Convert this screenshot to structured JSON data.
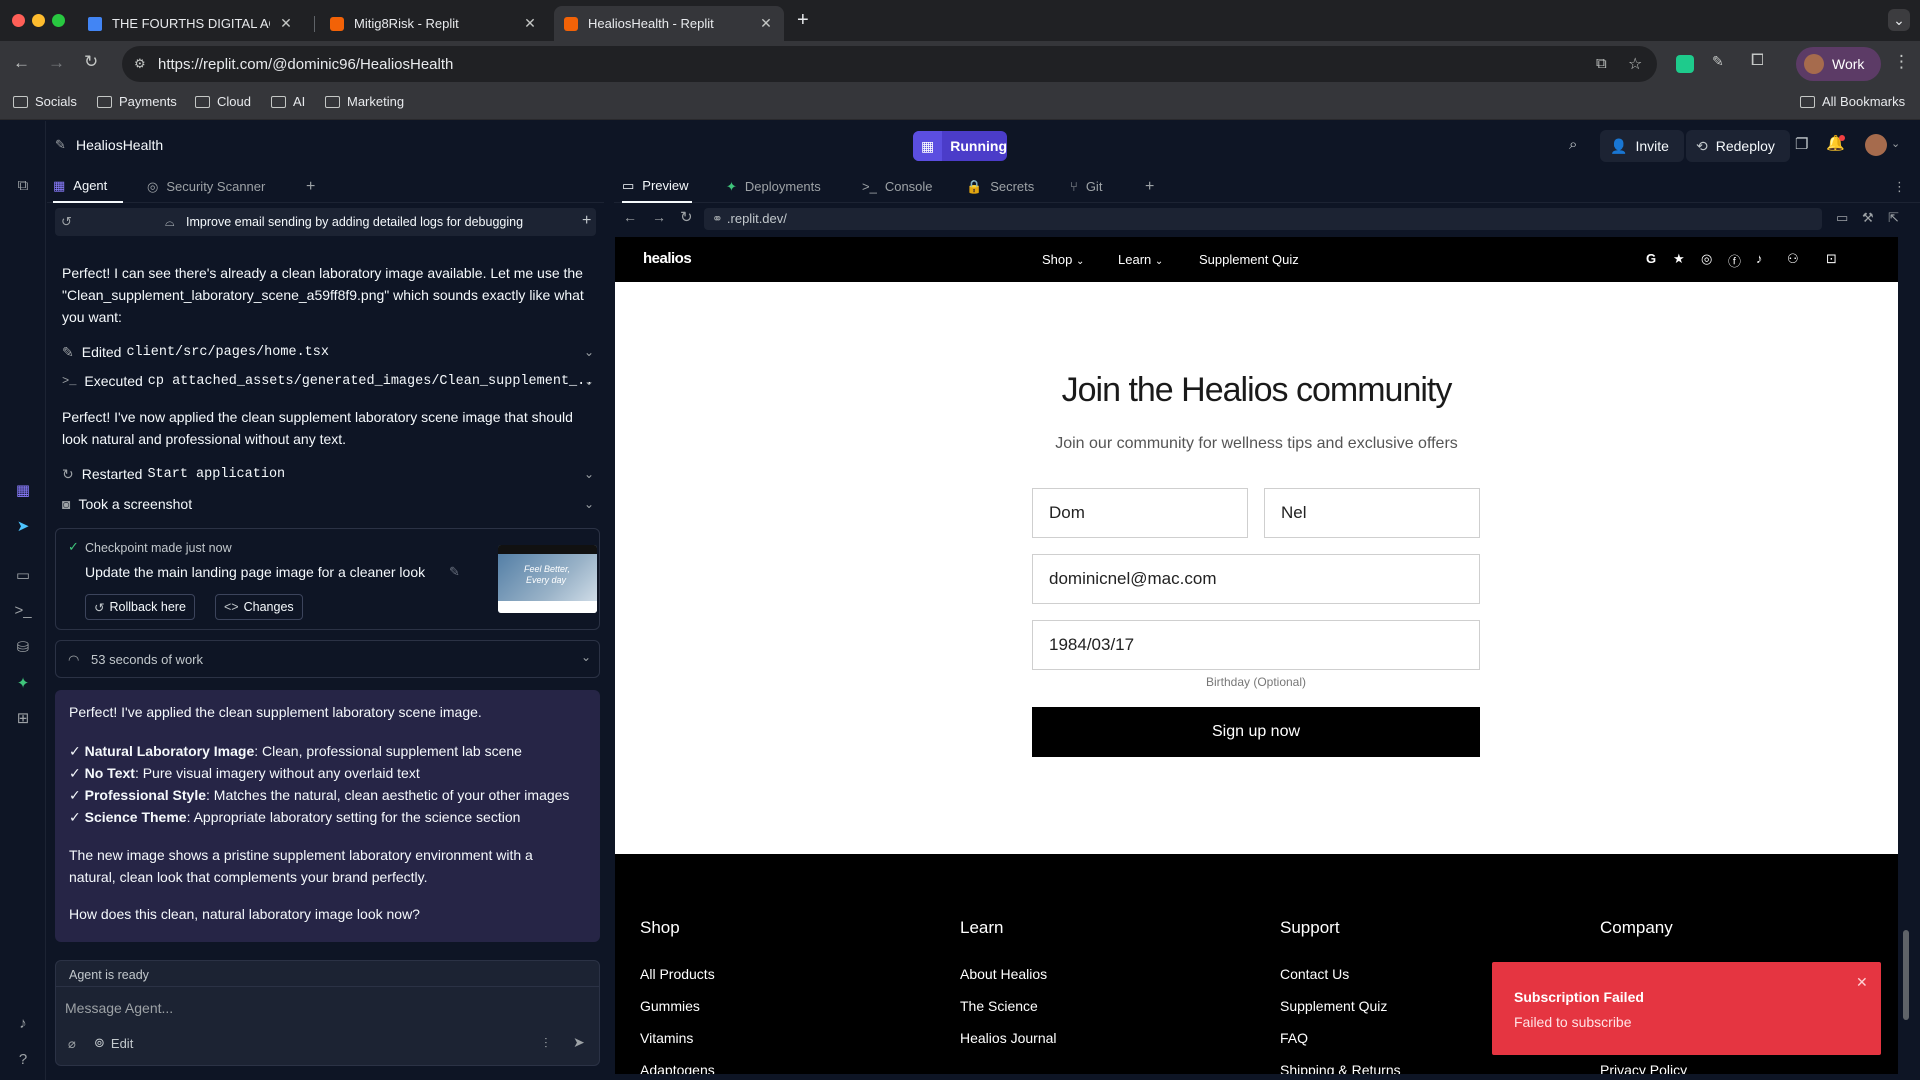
{
  "browser": {
    "tabs": [
      {
        "title": "THE FOURTHS DIGITAL AGEN"
      },
      {
        "title": "Mitig8Risk - Replit"
      },
      {
        "title": "HealiosHealth - Replit"
      }
    ],
    "url": "https://replit.com/@dominic96/HealiosHealth",
    "profile_label": "Work",
    "bookmarks": [
      "Socials",
      "Payments",
      "Cloud",
      "AI",
      "Marketing"
    ],
    "all_bookmarks": "All Bookmarks"
  },
  "replit": {
    "project_name": "HealiosHealth",
    "status": "Running",
    "invite_label": "Invite",
    "redeploy_label": "Redeploy",
    "left_tabs": [
      "Agent",
      "Security Scanner"
    ],
    "right_tabs": [
      "Preview",
      "Deployments",
      "Console",
      "Secrets",
      "Git"
    ],
    "preview_url": ".replit.dev/"
  },
  "agent": {
    "chat_title": "Improve email sending by adding detailed logs for debugging",
    "msg1": "Perfect! I can see there's already a clean laboratory image available. Let me use the \"Clean_supplement_laboratory_scene_a59ff8f9.png\" which sounds exactly like what you want:",
    "edited_label": "Edited",
    "edited_file": "client/src/pages/home.tsx",
    "executed_label": "Executed",
    "executed_cmd": "cp attached_assets/generated_images/Clean_supplement_...",
    "msg2": "Perfect! I've now applied the clean supplement laboratory scene image that should look natural and professional without any text.",
    "restarted_label": "Restarted",
    "restarted_name": "Start application",
    "screenshot_label": "Took a screenshot",
    "checkpoint": {
      "status": "Checkpoint made just now",
      "title": "Update the main landing page image for a cleaner look",
      "rollback": "Rollback here",
      "changes": "Changes",
      "thumb_text1": "Feel Better,",
      "thumb_text2": "Every day"
    },
    "work_time": "53 seconds of work",
    "final": {
      "intro": "Perfect! I've applied the clean supplement laboratory scene image.",
      "points": [
        {
          "bold": "Natural Laboratory Image",
          "text": ": Clean, professional supplement lab scene"
        },
        {
          "bold": "No Text",
          "text": ": Pure visual imagery without any overlaid text"
        },
        {
          "bold": "Professional Style",
          "text": ": Matches the natural, clean aesthetic of your other images"
        },
        {
          "bold": "Science Theme",
          "text": ": Appropriate laboratory setting for the science section"
        }
      ],
      "check": "✓",
      "para": "The new image shows a pristine supplement laboratory environment with a natural, clean look that complements your brand perfectly.",
      "question": "How does this clean, natural laboratory image look now?"
    },
    "ready": "Agent is ready",
    "input_placeholder": "Message Agent...",
    "edit_label": "Edit"
  },
  "site": {
    "logo": "healios",
    "nav": [
      "Shop",
      "Learn",
      "Supplement Quiz"
    ],
    "title": "Join the Healios community",
    "subtitle": "Join our community for wellness tips and exclusive offers",
    "first_name": "Dom",
    "last_name": "Nel",
    "email": "dominicnel@mac.com",
    "birthday": "1984/03/17",
    "birthday_hint": "Birthday (Optional)",
    "signup": "Sign up now",
    "footer": {
      "columns": [
        {
          "heading": "Shop",
          "links": [
            "All Products",
            "Gummies",
            "Vitamins",
            "Adaptogens"
          ]
        },
        {
          "heading": "Learn",
          "links": [
            "About Healios",
            "The Science",
            "Healios Journal"
          ]
        },
        {
          "heading": "Support",
          "links": [
            "Contact Us",
            "Supplement Quiz",
            "FAQ",
            "Shipping & Returns"
          ]
        },
        {
          "heading": "Company",
          "links": [
            "Privacy Policy"
          ]
        }
      ]
    }
  },
  "toast": {
    "title": "Subscription Failed",
    "message": "Failed to subscribe",
    "color": "#e53541"
  }
}
